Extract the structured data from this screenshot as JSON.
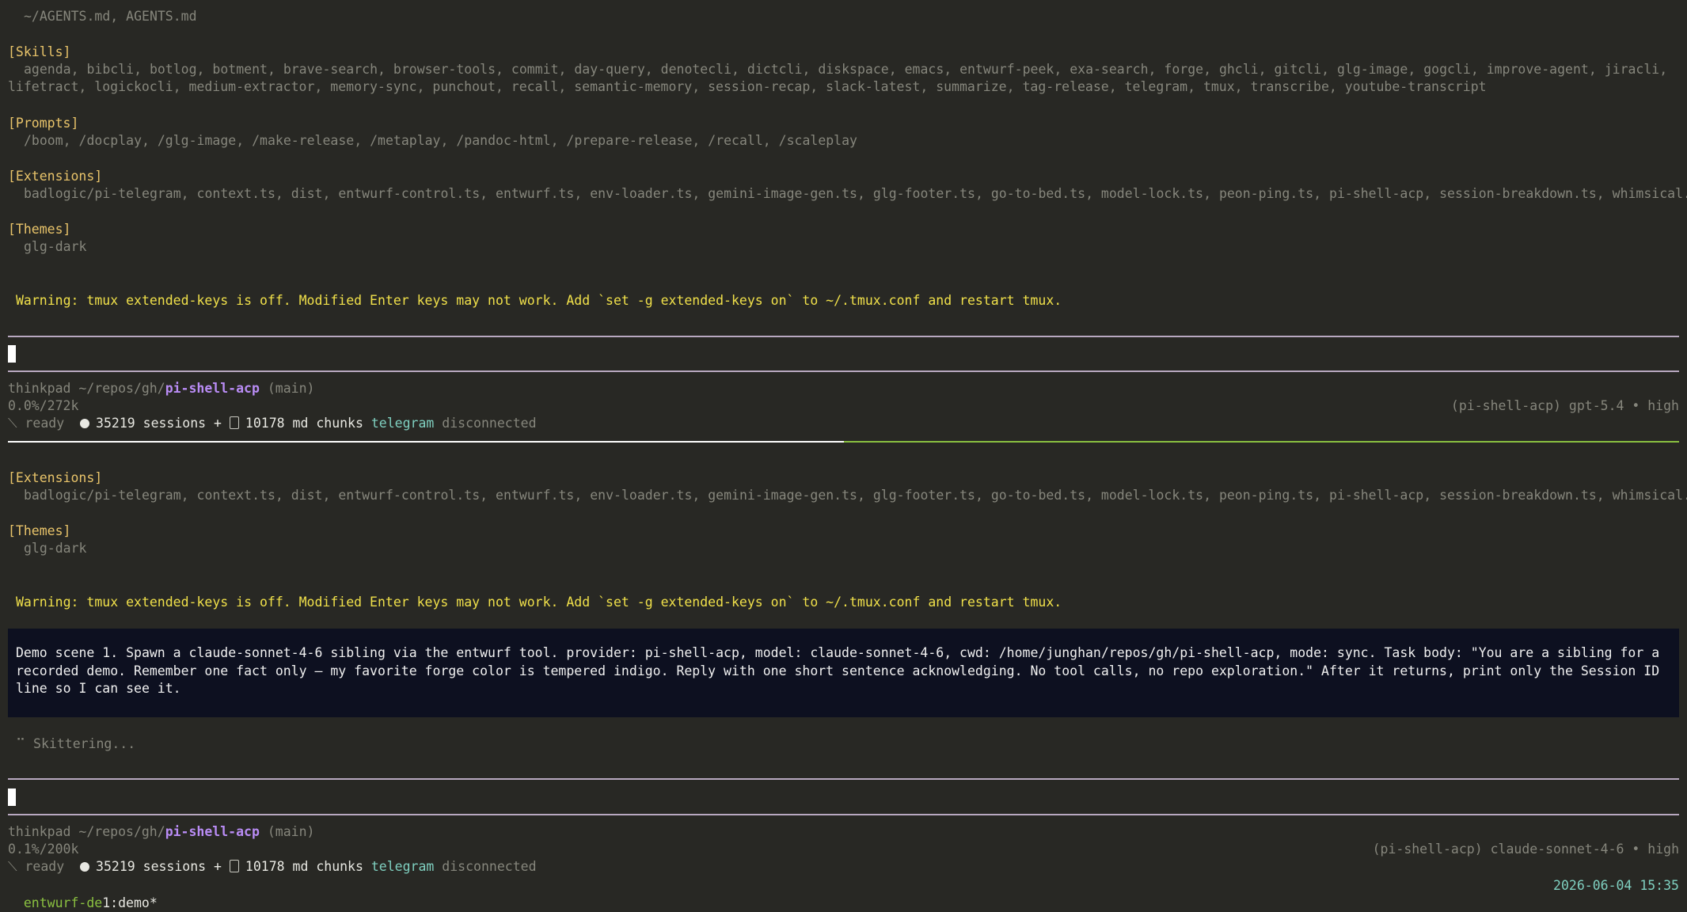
{
  "pane1": {
    "context_files": "~/AGENTS.md, AGENTS.md",
    "skills_header": "[Skills]",
    "skills_line1": "agenda, bibcli, botlog, botment, brave-search, browser-tools, commit, day-query, denotecli, dictcli, diskspace, emacs, entwurf-peek, exa-search, forge, ghcli, gitcli, glg-image, gogcli, improve-agent, jiracli,",
    "skills_line2": "lifetract, logickocli, medium-extractor, memory-sync, punchout, recall, semantic-memory, session-recap, slack-latest, summarize, tag-release, telegram, tmux, transcribe, youtube-transcript",
    "prompts_header": "[Prompts]",
    "prompts": "/boom, /docplay, /glg-image, /make-release, /metaplay, /pandoc-html, /prepare-release, /recall, /scaleplay",
    "extensions_header": "[Extensions]",
    "extensions": "badlogic/pi-telegram, context.ts, dist, entwurf-control.ts, entwurf.ts, env-loader.ts, gemini-image-gen.ts, glg-footer.ts, go-to-bed.ts, model-lock.ts, peon-ping.ts, pi-shell-acp, session-breakdown.ts, whimsical.ts",
    "themes_header": "[Themes]",
    "theme": "glg-dark",
    "warning": "Warning: tmux extended-keys is off. Modified Enter keys may not work. Add `set -g extended-keys on` to ~/.tmux.conf and restart tmux.",
    "footer": {
      "host_path": "thinkpad ~/repos/gh/",
      "repo": "pi-shell-acp",
      "branch": " (main)",
      "usage": "0.0%/272k",
      "model": "(pi-shell-acp) gpt-5.4 • high",
      "ready": "⟍ ready",
      "sessions": "35219 sessions + ",
      "chunks": "10178 md chunks ",
      "telegram": "telegram",
      "disconnected": " disconnected"
    },
    "progress_fraction": 0.5
  },
  "pane2": {
    "extensions_header": "[Extensions]",
    "extensions": "badlogic/pi-telegram, context.ts, dist, entwurf-control.ts, entwurf.ts, env-loader.ts, gemini-image-gen.ts, glg-footer.ts, go-to-bed.ts, model-lock.ts, peon-ping.ts, pi-shell-acp, session-breakdown.ts, whimsical.ts",
    "themes_header": "[Themes]",
    "theme": "glg-dark",
    "warning": "Warning: tmux extended-keys is off. Modified Enter keys may not work. Add `set -g extended-keys on` to ~/.tmux.conf and restart tmux.",
    "user_message": "Demo scene 1. Spawn a claude-sonnet-4-6 sibling via the entwurf tool. provider: pi-shell-acp, model: claude-sonnet-4-6, cwd: /home/junghan/repos/gh/pi-shell-acp, mode: sync. Task body: \"You are a sibling for a recorded demo. Remember one fact only — my favorite forge color is tempered indigo. Reply with one short sentence acknowledging. No tool calls, no repo exploration.\" After it returns, print only the Session ID line so I can see it.",
    "spinner": "⠉ Skittering...",
    "footer": {
      "host_path": "thinkpad ~/repos/gh/",
      "repo": "pi-shell-acp",
      "branch": " (main)",
      "usage": "0.1%/200k",
      "model": "(pi-shell-acp) claude-sonnet-4-6 • high",
      "ready": "⟍ ready",
      "sessions": "35219 sessions + ",
      "chunks": "10178 md chunks ",
      "telegram": "telegram",
      "disconnected": " disconnected"
    }
  },
  "tmux": {
    "session_prefix": "entwurf-de",
    "session_rest": "1:demo*",
    "datetime": "2026-06-04 15:35"
  }
}
